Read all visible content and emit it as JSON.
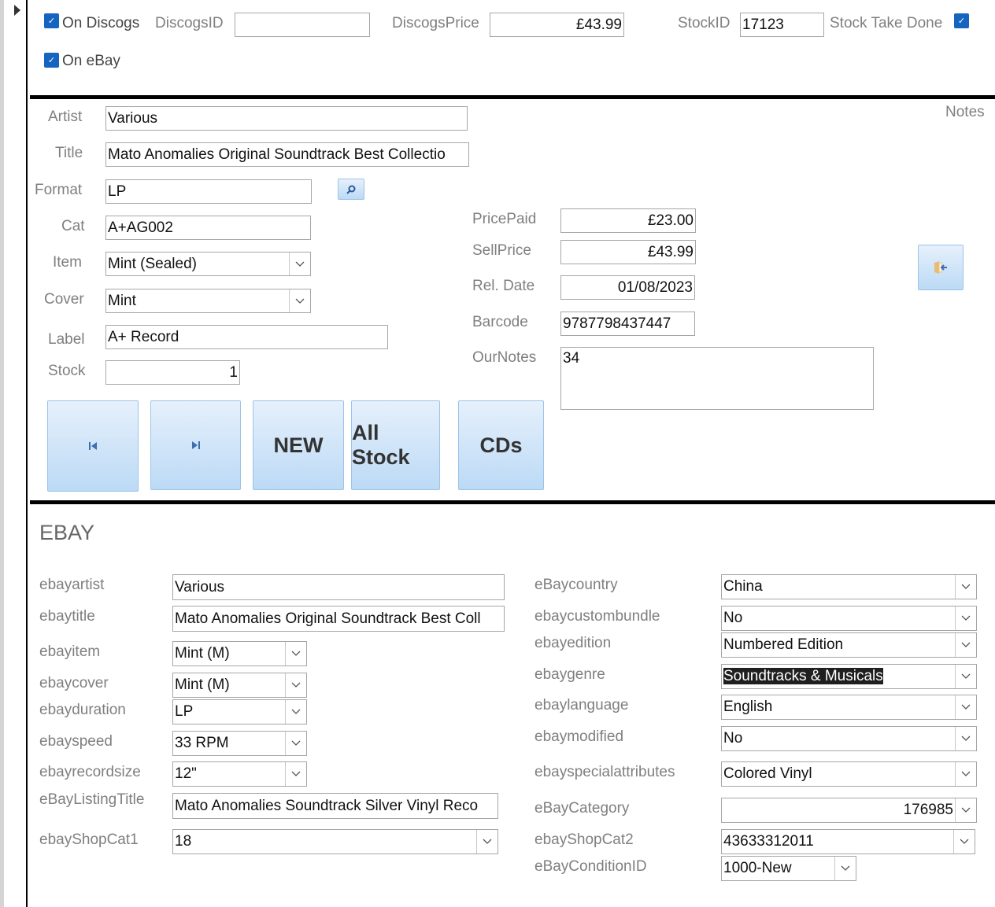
{
  "top": {
    "on_discogs": {
      "label": "On Discogs",
      "checked": true
    },
    "discogs_id": {
      "label": "DiscogsID",
      "value": ""
    },
    "discogs_price": {
      "label": "DiscogsPrice",
      "value": "£43.99"
    },
    "stock_id": {
      "label": "StockID",
      "value": "17123"
    },
    "stock_take_done": {
      "label": "Stock Take Done",
      "checked": true
    },
    "on_ebay": {
      "label": "On eBay",
      "checked": true
    }
  },
  "record": {
    "artist": {
      "label": "Artist",
      "value": "Various"
    },
    "title": {
      "label": "Title",
      "value": "Mato Anomalies Original Soundtrack Best Collectio"
    },
    "format": {
      "label": "Format",
      "value": "LP"
    },
    "cat": {
      "label": "Cat",
      "value": "A+AG002"
    },
    "item": {
      "label": "Item",
      "value": "Mint (Sealed)"
    },
    "cover": {
      "label": "Cover",
      "value": "Mint"
    },
    "label": {
      "label": "Label",
      "value": "A+ Record"
    },
    "stock": {
      "label": "Stock",
      "value": "1"
    },
    "price_paid": {
      "label": "PricePaid",
      "value": "£23.00"
    },
    "sell_price": {
      "label": "SellPrice",
      "value": "£43.99"
    },
    "rel_date": {
      "label": "Rel. Date",
      "value": "01/08/2023"
    },
    "barcode": {
      "label": "Barcode",
      "value": "9787798437447"
    },
    "our_notes": {
      "label": "OurNotes",
      "value": "34"
    },
    "notes_label": "Notes"
  },
  "buttons": {
    "first": "first-record-icon",
    "last": "last-record-icon",
    "new": "NEW",
    "all_stock": "All Stock",
    "cds": "CDs"
  },
  "ebay": {
    "heading": "EBAY",
    "ebayartist": {
      "label": "ebayartist",
      "value": "Various"
    },
    "ebaytitle": {
      "label": "ebaytitle",
      "value": "Mato Anomalies Original Soundtrack Best Coll"
    },
    "ebayitem": {
      "label": "ebayitem",
      "value": "Mint (M)"
    },
    "ebaycover": {
      "label": "ebaycover",
      "value": "Mint (M)"
    },
    "ebayduration": {
      "label": "ebayduration",
      "value": "LP"
    },
    "ebayspeed": {
      "label": "ebayspeed",
      "value": "33 RPM"
    },
    "ebayrecordsize": {
      "label": "ebayrecordsize",
      "value": "12\""
    },
    "ebaylistingtitle": {
      "label": "eBayListingTitle",
      "value": "Mato Anomalies Soundtrack Silver Vinyl Reco"
    },
    "ebayshopcat1": {
      "label": "ebayShopCat1",
      "value": "18"
    },
    "ebaycountry": {
      "label": "eBaycountry",
      "value": "China"
    },
    "ebaycustombundle": {
      "label": "ebaycustombundle",
      "value": "No"
    },
    "ebayedition": {
      "label": "ebayedition",
      "value": "Numbered Edition"
    },
    "ebaygenre": {
      "label": "ebaygenre",
      "value": "Soundtracks & Musicals"
    },
    "ebaylanguage": {
      "label": "ebaylanguage",
      "value": "English"
    },
    "ebaymodified": {
      "label": "ebaymodified",
      "value": "No"
    },
    "ebayspecialattributes": {
      "label": "ebayspecialattributes",
      "value": "Colored Vinyl"
    },
    "ebaycategory": {
      "label": "eBayCategory",
      "value": "176985"
    },
    "ebayshopcat2": {
      "label": "ebayShopCat2",
      "value": "43633312011"
    },
    "ebayconditionid": {
      "label": "eBayConditionID",
      "value": "1000-New"
    }
  }
}
